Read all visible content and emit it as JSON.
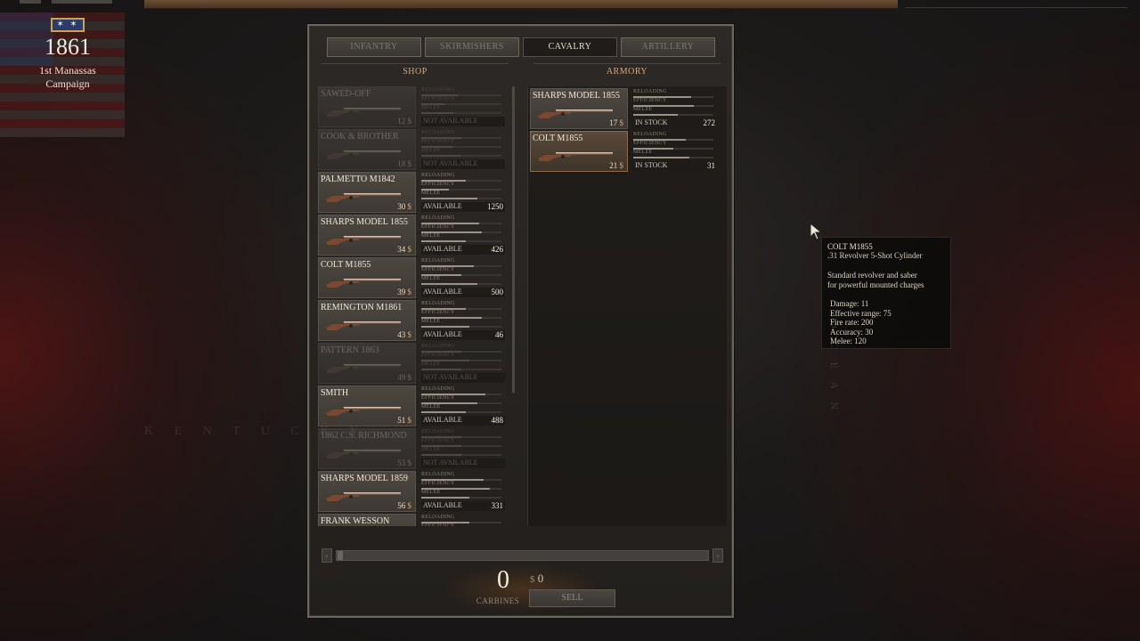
{
  "hud": {
    "rank_badge": "✶ ✶",
    "year": "1861",
    "campaign": "1st Manassas Campaign"
  },
  "tabs": [
    {
      "label": "INFANTRY",
      "active": false
    },
    {
      "label": "SKIRMISHERS",
      "active": false
    },
    {
      "label": "CAVALRY",
      "active": true
    },
    {
      "label": "ARTILLERY",
      "active": false
    }
  ],
  "shop": {
    "title": "SHOP",
    "stat_labels": [
      "RELOADING",
      "EFFICIENCY",
      "MELEE"
    ],
    "currency": "$",
    "items": [
      {
        "name": "SAWED-OFF",
        "price": "12",
        "status": "NOT AVAILABLE",
        "count": "",
        "available": false,
        "stats": [
          0.45,
          0.3,
          0.4
        ]
      },
      {
        "name": "COOK & BROTHER",
        "price": "18",
        "status": "NOT AVAILABLE",
        "count": "",
        "available": false,
        "stats": [
          0.5,
          0.4,
          0.5
        ]
      },
      {
        "name": "PALMETTO M1842",
        "price": "30",
        "status": "AVAILABLE",
        "count": "1250",
        "available": true,
        "stats": [
          0.55,
          0.35,
          0.7
        ]
      },
      {
        "name": "SHARPS MODEL 1855",
        "price": "34",
        "status": "AVAILABLE",
        "count": "426",
        "available": true,
        "stats": [
          0.72,
          0.75,
          0.55
        ]
      },
      {
        "name": "COLT M1855",
        "price": "39",
        "status": "AVAILABLE",
        "count": "500",
        "available": true,
        "stats": [
          0.65,
          0.5,
          0.7
        ]
      },
      {
        "name": "REMINGTON M1861",
        "price": "43",
        "status": "AVAILABLE",
        "count": "46",
        "available": true,
        "stats": [
          0.55,
          0.75,
          0.6
        ]
      },
      {
        "name": "PATTERN 1863",
        "price": "49",
        "status": "NOT AVAILABLE",
        "count": "",
        "available": false,
        "stats": [
          0.5,
          0.6,
          0.5
        ]
      },
      {
        "name": "SMITH",
        "price": "51",
        "status": "AVAILABLE",
        "count": "488",
        "available": true,
        "stats": [
          0.8,
          0.7,
          0.55
        ]
      },
      {
        "name": "1862 C.S. RICHMOND",
        "price": "53",
        "status": "NOT AVAILABLE",
        "count": "",
        "available": false,
        "stats": [
          0.5,
          0.5,
          0.5
        ]
      },
      {
        "name": "SHARPS MODEL 1859",
        "price": "56",
        "status": "AVAILABLE",
        "count": "331",
        "available": true,
        "stats": [
          0.78,
          0.85,
          0.6
        ]
      },
      {
        "name": "FRANK WESSON",
        "price": "",
        "status": "",
        "count": "",
        "available": true,
        "stats": [
          0.6,
          0.6,
          0.6
        ]
      }
    ]
  },
  "armory": {
    "title": "ARMORY",
    "items": [
      {
        "name": "SHARPS MODEL 1855",
        "price": "17",
        "status": "IN STOCK",
        "count": "272",
        "selected": false,
        "stats": [
          0.72,
          0.75,
          0.55
        ]
      },
      {
        "name": "COLT M1855",
        "price": "21",
        "status": "IN STOCK",
        "count": "31",
        "selected": true,
        "stats": [
          0.65,
          0.5,
          0.7
        ]
      }
    ]
  },
  "tooltip": {
    "name": "COLT M1855",
    "subtitle": ".31 Revolver 5-Shot Cylinder",
    "desc1": "Standard revolver and saber",
    "desc2": "for powerful mounted charges",
    "stats": [
      "Damage: 11",
      "Effective range: 75",
      "Fire rate: 200",
      "Accuracy: 30",
      "Melee: 120"
    ]
  },
  "transaction": {
    "quantity": "0",
    "unit": "CARBINES",
    "currency": "$",
    "amount": "0",
    "sell_label": "SELL"
  },
  "colors": {
    "accent_gold": "#d2a67a",
    "panel_border": "#6c655c",
    "active_tab_bg": "#1f1c1a",
    "confederate_red": "#8a1414"
  }
}
